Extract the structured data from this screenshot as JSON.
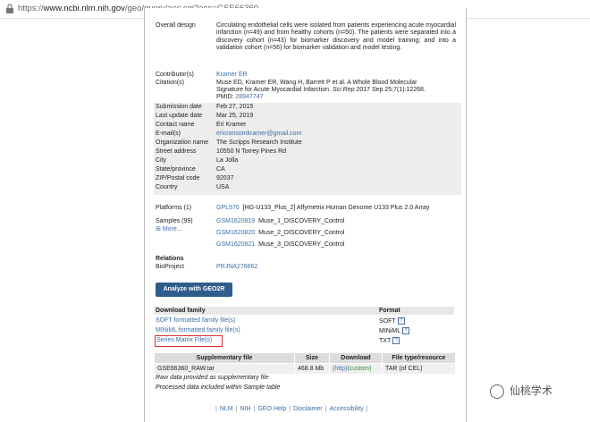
{
  "browser": {
    "url_prefix": "https://",
    "url_domain": "www.ncbi.nlm.nih.gov",
    "url_path": "/geo/query/acc.cgi?acc=GSE66360"
  },
  "overall_design": {
    "label": "Overall design",
    "value": "Circulating endothelial cells were isolated from patients experiencing acute myocardial infarction (n=49) and from healthy cohorts (n=50). The patients were separated into a discovery cohort (n=43) for biomarker discovery and model training; and into a validation cohort (n=56) for biomarker validation and model testing."
  },
  "contributors": {
    "label": "Contributor(s)",
    "value": "Kramer ER"
  },
  "citation": {
    "label": "Citation(s)",
    "line1": "Muse ED, Kramer ER, Wang H, Barrett P et al. A Whole Blood Molecular",
    "line2_a": "Signature for Acute Myocardial Infarction. ",
    "line2_journal": "Sci Rep",
    "line2_b": " 2017 Sep 25;7(1):12268.",
    "pmid_label": "PMID: ",
    "pmid": "28947747"
  },
  "submission": [
    {
      "label": "Submission date",
      "value": "Feb 27, 2015"
    },
    {
      "label": "Last update date",
      "value": "Mar 25, 2019"
    },
    {
      "label": "Contact name",
      "value": "Eri Kramer"
    },
    {
      "label": "E-mail(s)",
      "value": "ericransomkramer@gmail.com"
    },
    {
      "label": "Organization name",
      "value": "The Scripps Research Institute"
    },
    {
      "label": "Street address",
      "value": "10550 N Torrey Pines Rd"
    },
    {
      "label": "City",
      "value": "La Jolla"
    },
    {
      "label": "State/province",
      "value": "CA"
    },
    {
      "label": "ZIP/Postal code",
      "value": "92037"
    },
    {
      "label": "Country",
      "value": "USA"
    }
  ],
  "platforms": {
    "label": "Platforms (1)",
    "id": "GPL570",
    "desc": "[HG-U133_Plus_2] Affymetrix Human Genome U133 Plus 2.0 Array"
  },
  "samples": {
    "label": "Samples (99)",
    "more": "More...",
    "items": [
      {
        "id": "GSM1620819",
        "name": "Muse_1_DISCOVERY_Control"
      },
      {
        "id": "GSM1620820",
        "name": "Muse_2_DISCOVERY_Control"
      },
      {
        "id": "GSM1620821",
        "name": "Muse_3_DISCOVERY_Control"
      }
    ]
  },
  "relations": {
    "heading": "Relations",
    "label": "BioProject",
    "value": "PRJNA276662"
  },
  "analyze_button": "Analyze with GEO2R",
  "download": {
    "col_family": "Download family",
    "col_format": "Format",
    "rows": [
      {
        "name": "SOFT formatted family file(s)",
        "format": "SOFT"
      },
      {
        "name": "MINiML formatted family file(s)",
        "format": "MINiML"
      },
      {
        "name": "Series Matrix File(s)",
        "format": "TXT"
      }
    ]
  },
  "supplementary": {
    "headers": [
      "Supplementary file",
      "Size",
      "Download",
      "File type/resource"
    ],
    "file": "GSE66360_RAW.tar",
    "size": "468.8 Mb",
    "dl_http": "(http)",
    "dl_custom": "(custom)",
    "type": "TAR (of CEL)",
    "note1": "Raw data provided as supplementary file",
    "note2": "Processed data included within Sample table"
  },
  "footer": [
    "NLM",
    "NIH",
    "GEO Help",
    "Disclaimer",
    "Accessibility"
  ],
  "watermark": "仙桃学术",
  "help_icon": "?"
}
